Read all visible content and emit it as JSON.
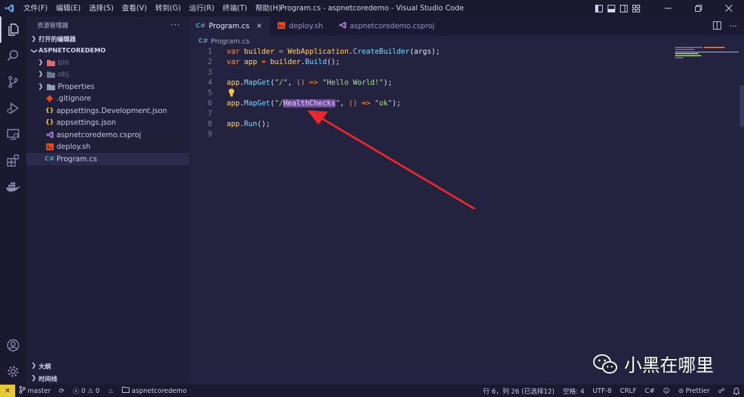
{
  "titlebar": {
    "menu": [
      "文件(F)",
      "编辑(E)",
      "选择(S)",
      "查看(V)",
      "转到(G)",
      "运行(R)",
      "终端(T)",
      "帮助(H)"
    ],
    "title": "Program.cs - aspnetcoredemo - Visual Studio Code"
  },
  "activitybar": {
    "items": [
      "explorer-icon",
      "search-icon",
      "source-control-icon",
      "run-debug-icon",
      "remote-explorer-icon",
      "extensions-icon",
      "docker-icon"
    ],
    "bottom": [
      "account-icon",
      "settings-gear-icon"
    ]
  },
  "sidebar": {
    "header": "资源管理器",
    "more": "···",
    "open_editors": "打开的编辑器",
    "project": "ASPNETCOREDEMO",
    "folders": [
      {
        "name": "bin",
        "dimmed": true
      },
      {
        "name": "obj",
        "dimmed": true
      },
      {
        "name": "Properties",
        "dimmed": false
      }
    ],
    "files": [
      {
        "name": ".gitignore",
        "icon": "git-icon",
        "color": "#e64a19"
      },
      {
        "name": "appsettings.Development.json",
        "icon": "{}",
        "color": "#f5c542"
      },
      {
        "name": "appsettings.json",
        "icon": "{}",
        "color": "#f5c542"
      },
      {
        "name": "aspnetcoredemo.csproj",
        "icon": "visual-studio-icon",
        "color": "#a074c4"
      },
      {
        "name": "deploy.sh",
        "icon": "terminal-icon",
        "color": "#e64a19"
      },
      {
        "name": "Program.cs",
        "icon": "C#",
        "color": "#519aba"
      }
    ],
    "outline": "大纲",
    "timeline": "时间线"
  },
  "tabs": [
    {
      "icon": "C#",
      "label": "Program.cs",
      "active": true
    },
    {
      "icon": "terminal-icon",
      "label": "deploy.sh",
      "active": false
    },
    {
      "icon": "visual-studio-icon",
      "label": "aspnetcoredemo.csproj",
      "active": false
    }
  ],
  "breadcrumb": {
    "icon": "C#",
    "label": "Program.cs"
  },
  "editor": {
    "line_numbers": [
      "1",
      "2",
      "3",
      "4",
      "5",
      "6",
      "7",
      "8",
      "9"
    ]
  },
  "watermark": {
    "text": "小黑在哪里"
  },
  "statusbar": {
    "remote": "✕",
    "branch": "master",
    "errors": "0",
    "warnings": "0",
    "project": "aspnetcoredemo",
    "position": "行 6，列 26 (已选择12)",
    "spaces": "空格: 4",
    "encoding": "UTF-8",
    "eol": "CRLF",
    "language": "C#",
    "prettier": "Prettier"
  },
  "colors": {
    "background": "#24233f",
    "sidebar": "#201f39",
    "statusbar": "#1a1930",
    "highlight": "#6e4e9c",
    "annotation_arrow": "#e8282d"
  }
}
